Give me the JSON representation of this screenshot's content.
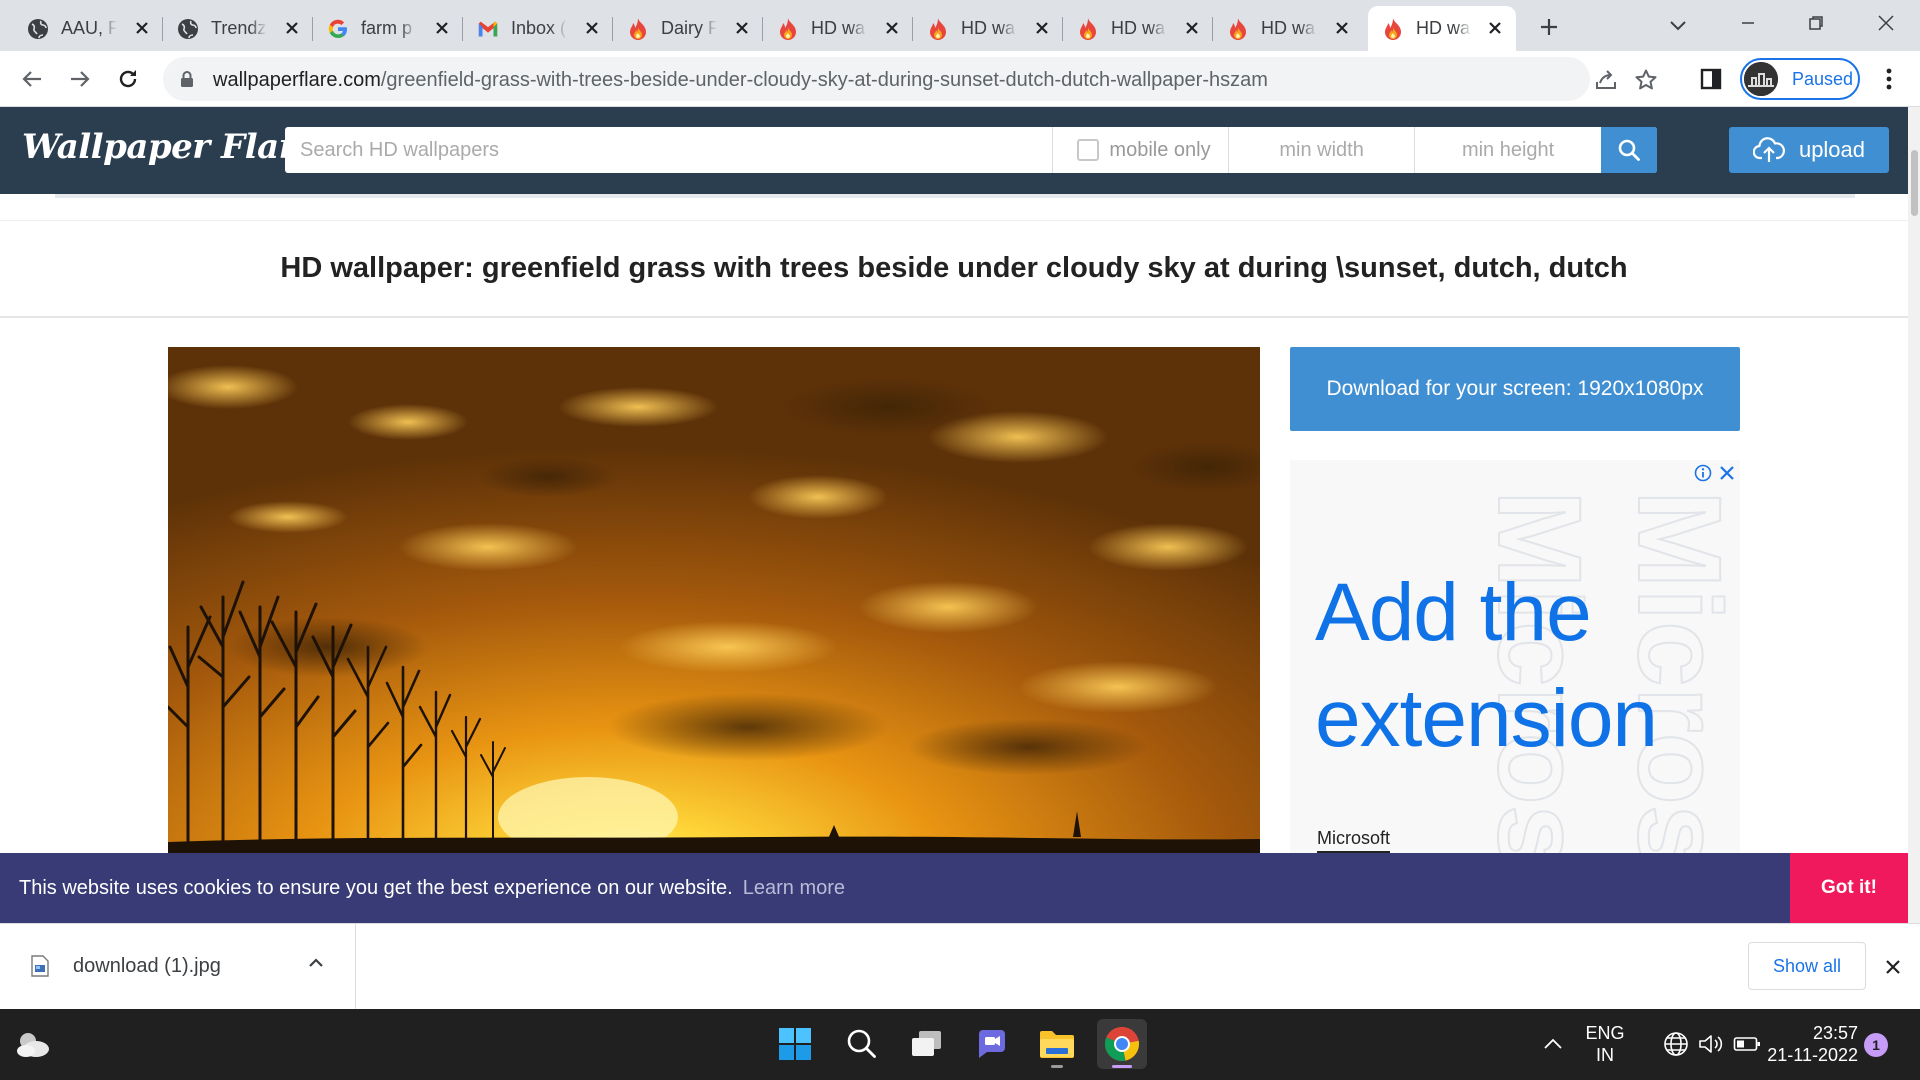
{
  "browser": {
    "tabs": [
      {
        "label": "AAU, F",
        "icon": "globe-icon"
      },
      {
        "label": "Trendz",
        "icon": "globe-icon"
      },
      {
        "label": "farm p",
        "icon": "google-icon"
      },
      {
        "label": "Inbox (",
        "icon": "gmail-icon"
      },
      {
        "label": "Dairy F",
        "icon": "flame-icon"
      },
      {
        "label": "HD wa",
        "icon": "flame-icon"
      },
      {
        "label": "HD wa",
        "icon": "flame-icon"
      },
      {
        "label": "HD wa",
        "icon": "flame-icon"
      },
      {
        "label": "HD wa",
        "icon": "flame-icon"
      },
      {
        "label": "HD wa",
        "icon": "flame-icon",
        "active": true
      }
    ],
    "url_host": "wallpaperflare.com",
    "url_path": "/greenfield-grass-with-trees-beside-under-cloudy-sky-at-during-sunset-dutch-dutch-wallpaper-hszam",
    "profile_status": "Paused"
  },
  "site": {
    "logo": "Wallpaper Flare",
    "search_placeholder": "Search HD wallpapers",
    "mobile_only_label": "mobile only",
    "min_width_placeholder": "min width",
    "min_height_placeholder": "min height",
    "upload_label": "upload",
    "accent_color": "#3f8fd2",
    "header_color": "#2b3e50"
  },
  "page": {
    "title": "HD wallpaper: greenfield grass with trees beside under cloudy sky at during \\sunset, dutch, dutch",
    "download_label": "Download for your screen: 1920x1080px"
  },
  "ad": {
    "headline": "Add the extension",
    "brand": "Microsoft",
    "info_icon": "info-icon",
    "close_icon": "close-icon"
  },
  "cookie": {
    "text": "This website uses cookies to ensure you get the best experience on our website.",
    "learn_more": "Learn more",
    "accept": "Got it!",
    "accept_color": "#f1195d"
  },
  "downloads": {
    "file_name": "download (1).jpg",
    "show_all": "Show all"
  },
  "taskbar": {
    "lang_line1": "ENG",
    "lang_line2": "IN",
    "time": "23:57",
    "date": "21-11-2022",
    "notification_count": "1"
  }
}
